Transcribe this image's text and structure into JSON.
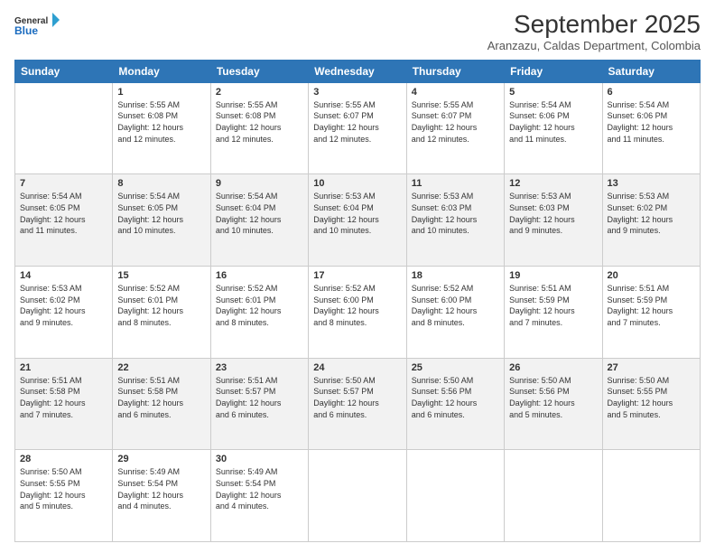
{
  "header": {
    "logo_line1": "General",
    "logo_line2": "Blue",
    "title": "September 2025",
    "subtitle": "Aranzazu, Caldas Department, Colombia"
  },
  "days_of_week": [
    "Sunday",
    "Monday",
    "Tuesday",
    "Wednesday",
    "Thursday",
    "Friday",
    "Saturday"
  ],
  "weeks": [
    [
      {
        "day": "",
        "info": ""
      },
      {
        "day": "1",
        "info": "Sunrise: 5:55 AM\nSunset: 6:08 PM\nDaylight: 12 hours\nand 12 minutes."
      },
      {
        "day": "2",
        "info": "Sunrise: 5:55 AM\nSunset: 6:08 PM\nDaylight: 12 hours\nand 12 minutes."
      },
      {
        "day": "3",
        "info": "Sunrise: 5:55 AM\nSunset: 6:07 PM\nDaylight: 12 hours\nand 12 minutes."
      },
      {
        "day": "4",
        "info": "Sunrise: 5:55 AM\nSunset: 6:07 PM\nDaylight: 12 hours\nand 12 minutes."
      },
      {
        "day": "5",
        "info": "Sunrise: 5:54 AM\nSunset: 6:06 PM\nDaylight: 12 hours\nand 11 minutes."
      },
      {
        "day": "6",
        "info": "Sunrise: 5:54 AM\nSunset: 6:06 PM\nDaylight: 12 hours\nand 11 minutes."
      }
    ],
    [
      {
        "day": "7",
        "info": "Sunrise: 5:54 AM\nSunset: 6:05 PM\nDaylight: 12 hours\nand 11 minutes."
      },
      {
        "day": "8",
        "info": "Sunrise: 5:54 AM\nSunset: 6:05 PM\nDaylight: 12 hours\nand 10 minutes."
      },
      {
        "day": "9",
        "info": "Sunrise: 5:54 AM\nSunset: 6:04 PM\nDaylight: 12 hours\nand 10 minutes."
      },
      {
        "day": "10",
        "info": "Sunrise: 5:53 AM\nSunset: 6:04 PM\nDaylight: 12 hours\nand 10 minutes."
      },
      {
        "day": "11",
        "info": "Sunrise: 5:53 AM\nSunset: 6:03 PM\nDaylight: 12 hours\nand 10 minutes."
      },
      {
        "day": "12",
        "info": "Sunrise: 5:53 AM\nSunset: 6:03 PM\nDaylight: 12 hours\nand 9 minutes."
      },
      {
        "day": "13",
        "info": "Sunrise: 5:53 AM\nSunset: 6:02 PM\nDaylight: 12 hours\nand 9 minutes."
      }
    ],
    [
      {
        "day": "14",
        "info": "Sunrise: 5:53 AM\nSunset: 6:02 PM\nDaylight: 12 hours\nand 9 minutes."
      },
      {
        "day": "15",
        "info": "Sunrise: 5:52 AM\nSunset: 6:01 PM\nDaylight: 12 hours\nand 8 minutes."
      },
      {
        "day": "16",
        "info": "Sunrise: 5:52 AM\nSunset: 6:01 PM\nDaylight: 12 hours\nand 8 minutes."
      },
      {
        "day": "17",
        "info": "Sunrise: 5:52 AM\nSunset: 6:00 PM\nDaylight: 12 hours\nand 8 minutes."
      },
      {
        "day": "18",
        "info": "Sunrise: 5:52 AM\nSunset: 6:00 PM\nDaylight: 12 hours\nand 8 minutes."
      },
      {
        "day": "19",
        "info": "Sunrise: 5:51 AM\nSunset: 5:59 PM\nDaylight: 12 hours\nand 7 minutes."
      },
      {
        "day": "20",
        "info": "Sunrise: 5:51 AM\nSunset: 5:59 PM\nDaylight: 12 hours\nand 7 minutes."
      }
    ],
    [
      {
        "day": "21",
        "info": "Sunrise: 5:51 AM\nSunset: 5:58 PM\nDaylight: 12 hours\nand 7 minutes."
      },
      {
        "day": "22",
        "info": "Sunrise: 5:51 AM\nSunset: 5:58 PM\nDaylight: 12 hours\nand 6 minutes."
      },
      {
        "day": "23",
        "info": "Sunrise: 5:51 AM\nSunset: 5:57 PM\nDaylight: 12 hours\nand 6 minutes."
      },
      {
        "day": "24",
        "info": "Sunrise: 5:50 AM\nSunset: 5:57 PM\nDaylight: 12 hours\nand 6 minutes."
      },
      {
        "day": "25",
        "info": "Sunrise: 5:50 AM\nSunset: 5:56 PM\nDaylight: 12 hours\nand 6 minutes."
      },
      {
        "day": "26",
        "info": "Sunrise: 5:50 AM\nSunset: 5:56 PM\nDaylight: 12 hours\nand 5 minutes."
      },
      {
        "day": "27",
        "info": "Sunrise: 5:50 AM\nSunset: 5:55 PM\nDaylight: 12 hours\nand 5 minutes."
      }
    ],
    [
      {
        "day": "28",
        "info": "Sunrise: 5:50 AM\nSunset: 5:55 PM\nDaylight: 12 hours\nand 5 minutes."
      },
      {
        "day": "29",
        "info": "Sunrise: 5:49 AM\nSunset: 5:54 PM\nDaylight: 12 hours\nand 4 minutes."
      },
      {
        "day": "30",
        "info": "Sunrise: 5:49 AM\nSunset: 5:54 PM\nDaylight: 12 hours\nand 4 minutes."
      },
      {
        "day": "",
        "info": ""
      },
      {
        "day": "",
        "info": ""
      },
      {
        "day": "",
        "info": ""
      },
      {
        "day": "",
        "info": ""
      }
    ]
  ]
}
